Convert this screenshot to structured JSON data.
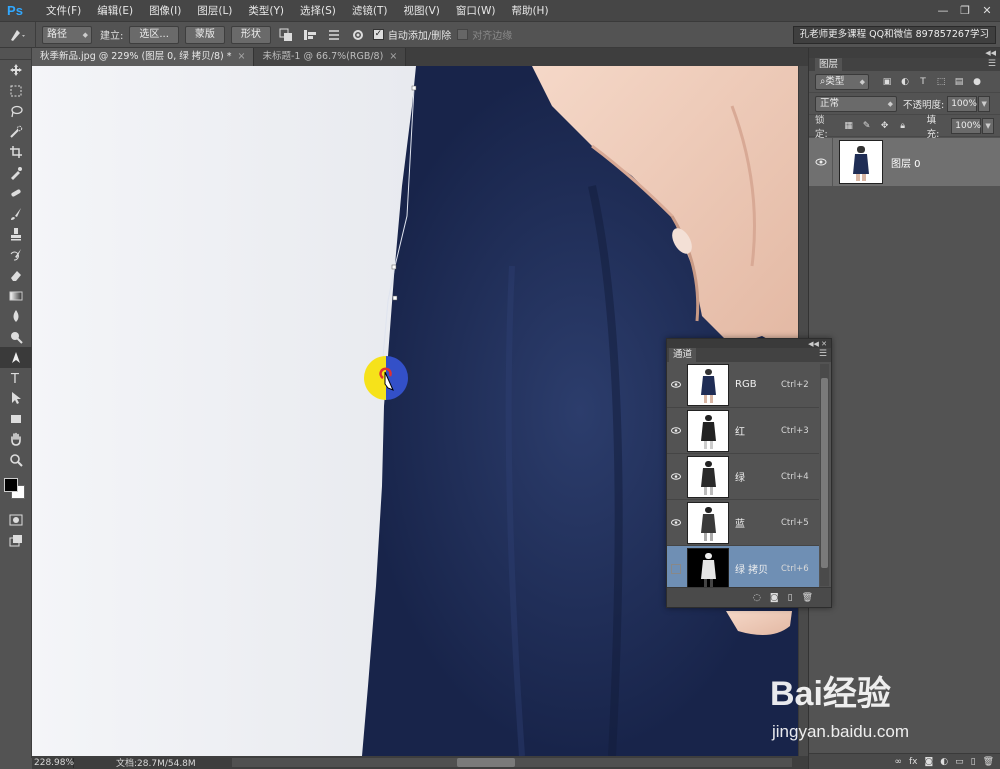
{
  "app": {
    "logo": "Ps"
  },
  "menu": [
    "文件(F)",
    "编辑(E)",
    "图像(I)",
    "图层(L)",
    "类型(Y)",
    "选择(S)",
    "滤镜(T)",
    "视图(V)",
    "窗口(W)",
    "帮助(H)"
  ],
  "options": {
    "mode": "路径",
    "make_label": "建立:",
    "selection_btn": "选区...",
    "mask_btn": "蒙版",
    "shape_btn": "形状",
    "auto_add_delete": "自动添加/删除",
    "align_edges": "对齐边缘",
    "right_badge": "孔老师更多课程 QQ和微信 897857267学习"
  },
  "tabs": [
    {
      "label": "秋季新品.jpg @ 229% (图层 0, 绿 拷贝/8) *",
      "close": "×"
    },
    {
      "label": "未标题-1 @ 66.7%(RGB/8)",
      "close": "×"
    }
  ],
  "status": {
    "zoom": "228.98%",
    "doc": "文档:28.7M/54.8M"
  },
  "layers_panel": {
    "tab": "图层",
    "filter": "类型",
    "blend_mode": "正常",
    "opacity_label": "不透明度:",
    "opacity": "100%",
    "lock_label": "锁定:",
    "fill_label": "填充:",
    "fill": "100%",
    "layer_name": "图层 0"
  },
  "channels_panel": {
    "tab": "通道",
    "rows": [
      {
        "name": "RGB",
        "shortcut": "Ctrl+2"
      },
      {
        "name": "红",
        "shortcut": "Ctrl+3"
      },
      {
        "name": "绿",
        "shortcut": "Ctrl+4"
      },
      {
        "name": "蓝",
        "shortcut": "Ctrl+5"
      },
      {
        "name": "绿 拷贝",
        "shortcut": "Ctrl+6"
      }
    ]
  },
  "watermark": {
    "brand": "Bai经验",
    "url": "jingyan.baidu.com"
  },
  "colors": {
    "accent": "#31a8ff",
    "selected_row": "#6f8fb4",
    "fabric": "#1f2d55"
  }
}
